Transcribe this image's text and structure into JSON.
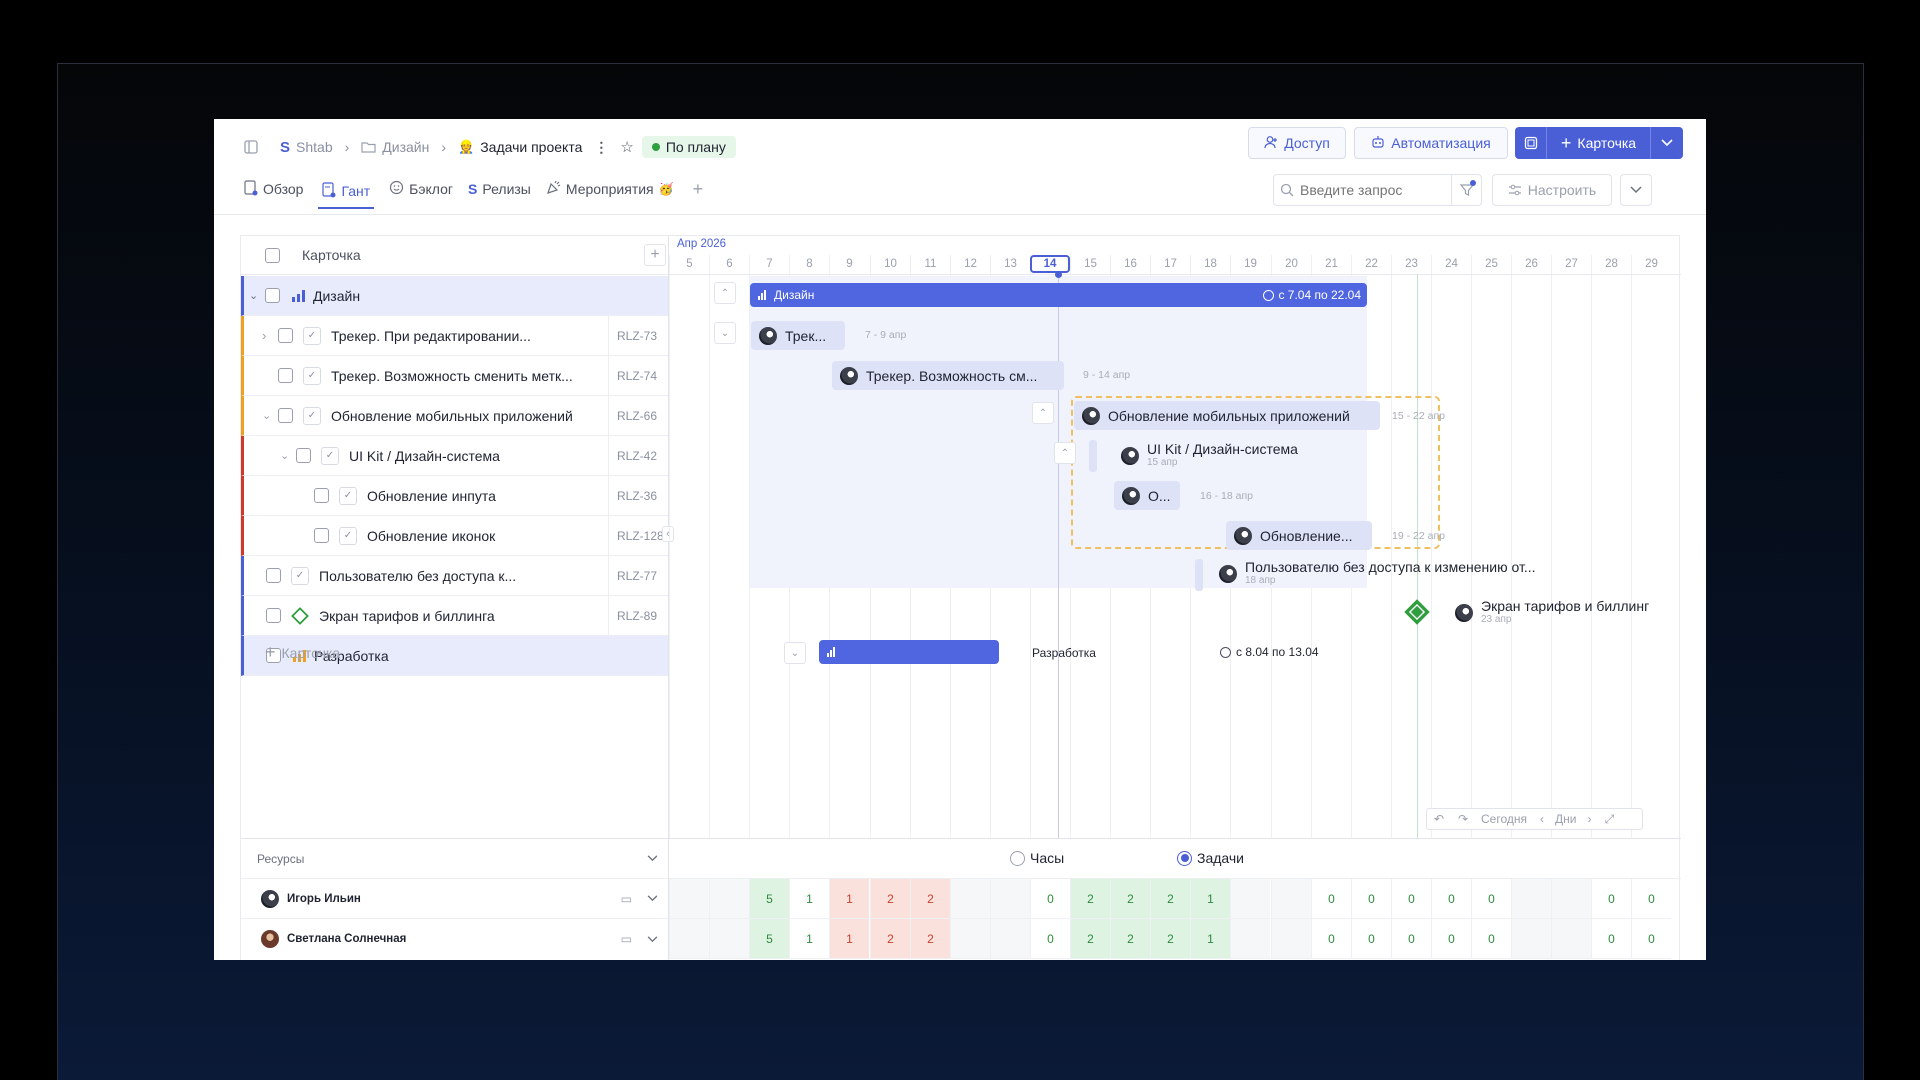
{
  "breadcrumb": {
    "workspace": "Shtab",
    "folder": "Дизайн",
    "project": "Задачи проекта",
    "status": "По плану"
  },
  "header_buttons": {
    "access": "Доступ",
    "automation": "Автоматизация",
    "card": "Карточка"
  },
  "tabs": [
    {
      "label": "Обзор"
    },
    {
      "label": "Гант",
      "active": true
    },
    {
      "label": "Бэклог"
    },
    {
      "label": "Релизы"
    },
    {
      "label": "Мероприятия"
    }
  ],
  "search": {
    "placeholder": "Введите запрос"
  },
  "configure": "Настроить",
  "list": {
    "header": "Карточка",
    "add_card": "Карточка",
    "rows": [
      {
        "title": "Дизайн",
        "key": ""
      },
      {
        "title": "Трекер. При редактировании...",
        "key": "RLZ-73"
      },
      {
        "title": "Трекер. Возможность сменить метк...",
        "key": "RLZ-74"
      },
      {
        "title": "Обновление мобильных приложений",
        "key": "RLZ-66"
      },
      {
        "title": "UI Kit / Дизайн-система",
        "key": "RLZ-42"
      },
      {
        "title": "Обновление инпута",
        "key": "RLZ-36"
      },
      {
        "title": "Обновление иконок",
        "key": "RLZ-128"
      },
      {
        "title": "Пользователю без доступа к...",
        "key": "RLZ-77"
      },
      {
        "title": "Экран тарифов и биллинга",
        "key": "RLZ-89"
      },
      {
        "title": "Разработка",
        "key": ""
      }
    ]
  },
  "timeline": {
    "month": "Апр 2026",
    "days": [
      "5",
      "6",
      "7",
      "8",
      "9",
      "10",
      "11",
      "12",
      "13",
      "14",
      "15",
      "16",
      "17",
      "18",
      "19",
      "20",
      "21",
      "22",
      "23",
      "24",
      "25",
      "26",
      "27",
      "28",
      "29"
    ],
    "today": "14"
  },
  "bars": {
    "design": {
      "label": "Дизайн",
      "range": "с 7.04 по 22.04"
    },
    "tracker1": {
      "label": "Трек...",
      "dates": "7 - 9 апр"
    },
    "tracker2": {
      "label": "Трекер. Возможность см...",
      "dates": "9 - 14 апр"
    },
    "mobile": {
      "label": "Обновление мобильных приложений",
      "dates": "15 - 22 апр"
    },
    "uikit": {
      "label": "UI Kit / Дизайн-система",
      "dates": "15 апр"
    },
    "input": {
      "label": "О...",
      "dates": "16 - 18 апр"
    },
    "icons": {
      "label": "Обновление...",
      "dates": "19 - 22 апр"
    },
    "noaccess": {
      "label": "Пользователю без доступа к изменению от...",
      "dates": "18 апр"
    },
    "billing": {
      "label": "Экран тарифов и биллинг",
      "dates": "23 апр"
    },
    "dev": {
      "label": "Разработка",
      "range": "с 8.04 по 13.04"
    }
  },
  "gantt_controls": {
    "today": "Сегодня",
    "scale": "Дни"
  },
  "resources": {
    "label": "Ресурсы",
    "mode_hours": "Часы",
    "mode_tasks": "Задачи",
    "selected": "Задачи",
    "people": [
      {
        "name": "Игорь Ильин",
        "values": [
          "",
          "",
          "5",
          "1",
          "1",
          "2",
          "2",
          "",
          "",
          "0",
          "2",
          "2",
          "2",
          "1",
          "",
          "",
          "0",
          "0",
          "0",
          "0",
          "0",
          "",
          "",
          "0",
          "0"
        ]
      },
      {
        "name": "Светлана Солнечная",
        "values": [
          "",
          "",
          "5",
          "1",
          "1",
          "2",
          "2",
          "",
          "",
          "0",
          "2",
          "2",
          "2",
          "1",
          "",
          "",
          "0",
          "0",
          "0",
          "0",
          "0",
          "",
          "",
          "0",
          "0"
        ]
      }
    ]
  },
  "colors": {
    "accent": "#4a5fd6",
    "bar": "#4f66e0",
    "light_bar": "#e8ebfb",
    "green": "#2e9e3e",
    "orange": "#f0a020",
    "red": "#d03a2a"
  }
}
